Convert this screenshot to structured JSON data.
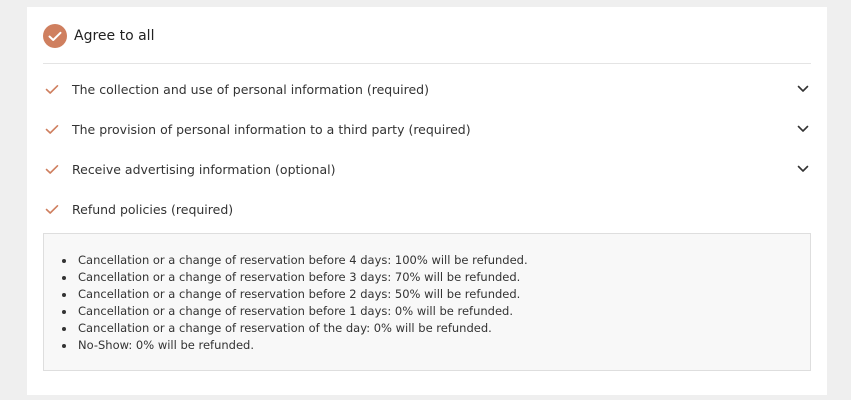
{
  "agree_all": {
    "label": "Agree to all",
    "checked": true
  },
  "terms": [
    {
      "label": "The collection and use of personal information (required)",
      "checked": true,
      "expandable": true
    },
    {
      "label": "The provision of personal information to a third party (required)",
      "checked": true,
      "expandable": true
    },
    {
      "label": "Receive advertising information (optional)",
      "checked": true,
      "expandable": true
    },
    {
      "label": "Refund policies (required)",
      "checked": true,
      "expandable": false
    }
  ],
  "refund_policies": [
    "Cancellation or a change of reservation before 4 days: 100% will be refunded.",
    "Cancellation or a change of reservation before 3 days: 70% will be refunded.",
    "Cancellation or a change of reservation before 2 days: 50% will be refunded.",
    "Cancellation or a change of reservation before 1 days: 0% will be refunded.",
    "Cancellation or a change of reservation of the day: 0% will be refunded.",
    "No-Show: 0% will be refunded."
  ],
  "colors": {
    "accent": "#cf7f5f",
    "chevron": "#333333"
  },
  "icons": {
    "check": "check-icon",
    "chevron": "chevron-down-icon"
  }
}
